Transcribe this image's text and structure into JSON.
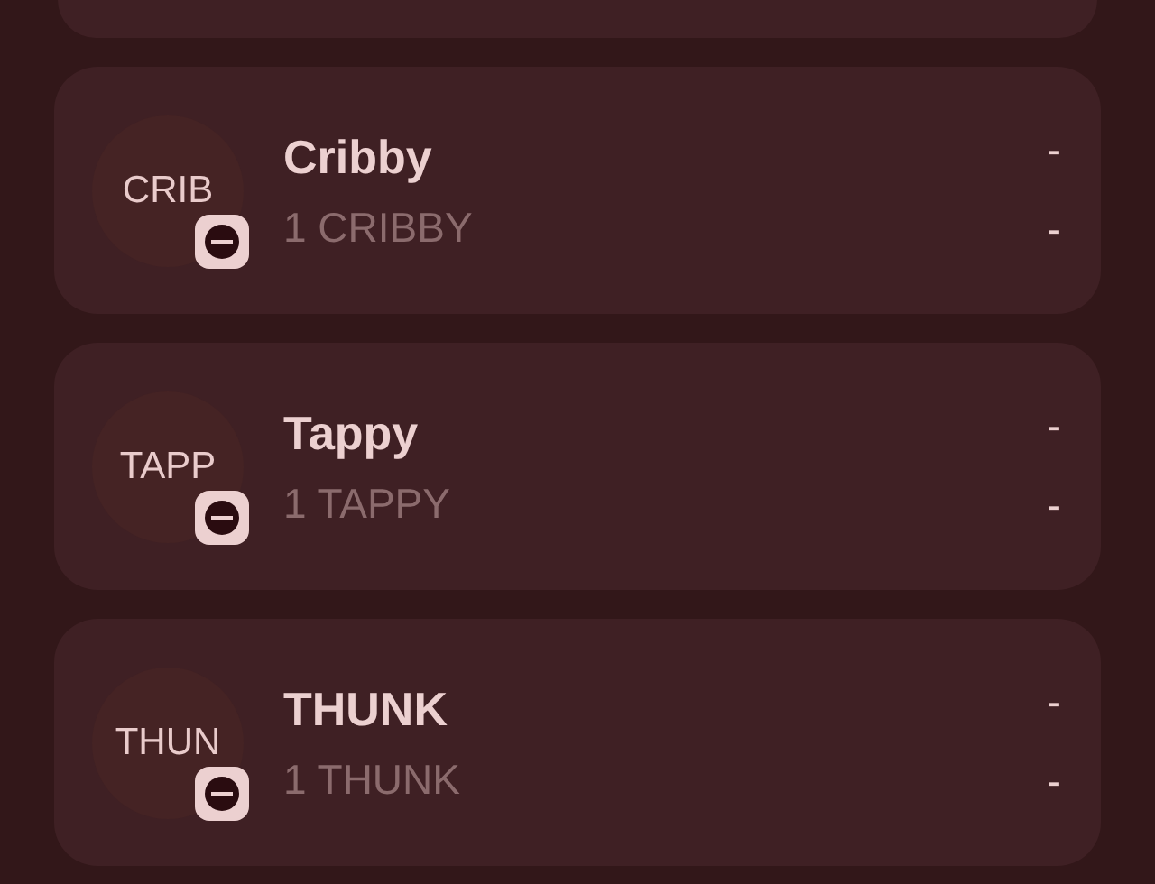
{
  "tokens": [
    {
      "avatar": "CRIB",
      "name": "Cribby",
      "amount": "1 CRIBBY",
      "value": "-",
      "change": "-"
    },
    {
      "avatar": "TAPP",
      "name": "Tappy",
      "amount": "1 TAPPY",
      "value": "-",
      "change": "-"
    },
    {
      "avatar": "THUN",
      "name": "THUNK",
      "amount": "1 THUNK",
      "value": "-",
      "change": "-"
    }
  ]
}
